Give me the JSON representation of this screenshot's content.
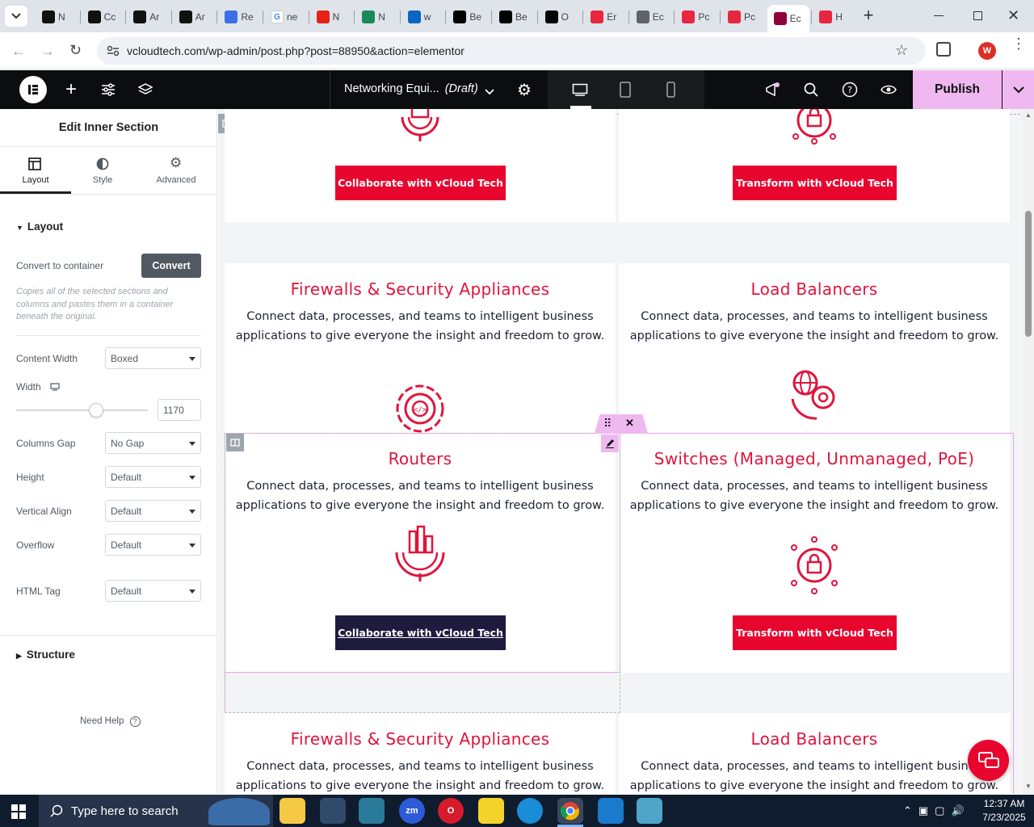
{
  "browser": {
    "tabs": [
      {
        "label": "N",
        "icon": "openai-icon"
      },
      {
        "label": "Cc",
        "icon": "openai-icon"
      },
      {
        "label": "Ar",
        "icon": "openai-icon"
      },
      {
        "label": "Ar",
        "icon": "openai-icon"
      },
      {
        "label": "Re",
        "icon": "rewrite-icon"
      },
      {
        "label": "ne",
        "icon": "google-icon"
      },
      {
        "label": "N",
        "icon": "youtube-icon"
      },
      {
        "label": "N",
        "icon": "w-icon"
      },
      {
        "label": "w",
        "icon": "linkedin-icon"
      },
      {
        "label": "Be",
        "icon": "x-icon"
      },
      {
        "label": "Be",
        "icon": "x-icon"
      },
      {
        "label": "O",
        "icon": "app-icon"
      },
      {
        "label": "Er",
        "icon": "elementor-diamond-icon"
      },
      {
        "label": "Ec",
        "icon": "globe-icon"
      },
      {
        "label": "Pc",
        "icon": "elementor-diamond-icon"
      },
      {
        "label": "Pc",
        "icon": "elementor-diamond-icon"
      },
      {
        "label": "Ec",
        "icon": "elementor-icon",
        "active": true
      },
      {
        "label": "H",
        "icon": "elementor-diamond-icon"
      }
    ],
    "url": "vcloudtech.com/wp-admin/post.php?post=88950&action=elementor"
  },
  "editor": {
    "document_title": "Networking Equi...",
    "document_status": "(Draft)",
    "publish_label": "Publish",
    "accent": "#f0b8f0"
  },
  "panel": {
    "title": "Edit Inner Section",
    "tabs": [
      "Layout",
      "Style",
      "Advanced"
    ],
    "section_layout": "Layout",
    "convert_label": "Convert to container",
    "convert_button": "Convert",
    "convert_help": "Copies all of the selected sections and columns and pastes them in a container beneath the original.",
    "content_width_label": "Content Width",
    "content_width_value": "Boxed",
    "width_label": "Width",
    "width_value": "1170",
    "columns_gap_label": "Columns Gap",
    "columns_gap_value": "No Gap",
    "height_label": "Height",
    "height_value": "Default",
    "vertical_align_label": "Vertical Align",
    "vertical_align_value": "Default",
    "overflow_label": "Overflow",
    "overflow_value": "Default",
    "html_tag_label": "HTML Tag",
    "html_tag_value": "Default",
    "section_structure": "Structure",
    "need_help": "Need Help"
  },
  "canvas": {
    "accent": "#e8062f",
    "dark_button": "#1e1b3e",
    "desc": "Connect data, processes, and teams to intelligent business applications to give everyone the insight and freedom to grow.",
    "btn_collaborate": "Collaborate with vCloud Tech",
    "btn_transform": "Transform with vCloud Tech",
    "titles": {
      "firewalls": "Firewalls & Security Appliances",
      "load_balancers": "Load Balancers",
      "routers": "Routers",
      "switches": "Switches (Managed, Unmanaged, PoE)"
    }
  },
  "taskbar": {
    "search_placeholder": "Type here to search",
    "time": "12:37 AM",
    "date": "7/23/2025"
  }
}
